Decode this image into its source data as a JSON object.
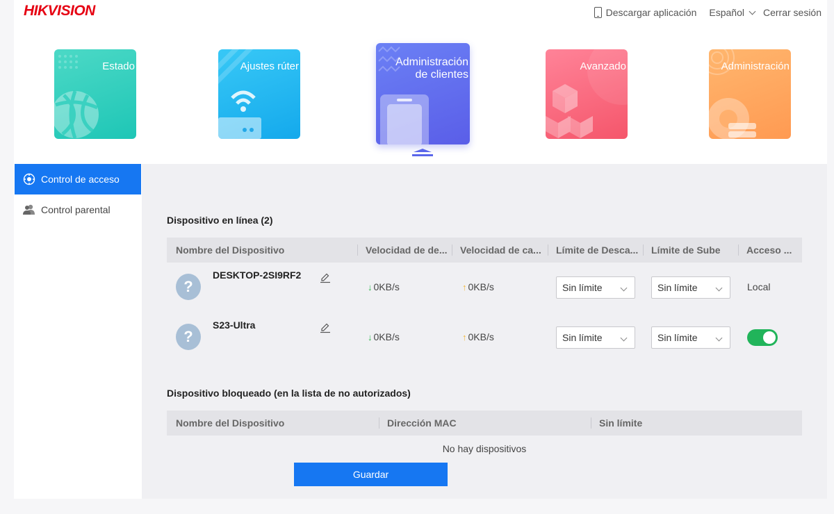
{
  "header": {
    "brand": "HIKVISION",
    "download_app": "Descargar aplicación",
    "language": "Español",
    "logout": "Cerrar sesión"
  },
  "tiles": [
    {
      "label": "Estado",
      "icon": "globe-icon",
      "color": "#2ecdbd"
    },
    {
      "label": "Ajustes rúter",
      "icon": "router-icon",
      "color": "#22b4f0"
    },
    {
      "label_line1": "Administración",
      "label_line2": "de clientes",
      "icon": "phone-clients-icon",
      "color": "#6271ef",
      "active": true
    },
    {
      "label": "Avanzado",
      "icon": "cubes-icon",
      "color": "#f86a7e"
    },
    {
      "label": "Administración",
      "icon": "gear-admin-icon",
      "color": "#ffa85f"
    }
  ],
  "sidebar": {
    "items": [
      {
        "label": "Control de acceso",
        "icon": "access-control-icon",
        "active": true
      },
      {
        "label": "Control parental",
        "icon": "parental-user-icon",
        "active": false
      }
    ]
  },
  "online": {
    "title": "Dispositivo en línea (2)",
    "columns": [
      "Nombre del Dispositivo",
      "Velocidad de de...",
      "Velocidad de ca...",
      "Límite de Desca...",
      "Límite de Sube",
      "Acceso ..."
    ],
    "rows": [
      {
        "name": "DESKTOP-2SI9RF2",
        "down": "0KB/s",
        "up": "0KB/s",
        "down_limit": "Sin límite",
        "up_limit": "Sin límite",
        "access": "Local"
      },
      {
        "name": "S23-Ultra",
        "down": "0KB/s",
        "up": "0KB/s",
        "down_limit": "Sin límite",
        "up_limit": "Sin límite",
        "access_toggle": true
      }
    ]
  },
  "blocked": {
    "title": "Dispositivo bloqueado (en la lista de no autorizados)",
    "columns": [
      "Nombre del Dispositivo",
      "Dirección MAC",
      "Sin límite"
    ],
    "empty": "No hay dispositivos"
  },
  "save_label": "Guardar",
  "colors": {
    "accent": "#1677f2",
    "toggle_on": "#21b45a",
    "brand_red": "#e60012"
  }
}
